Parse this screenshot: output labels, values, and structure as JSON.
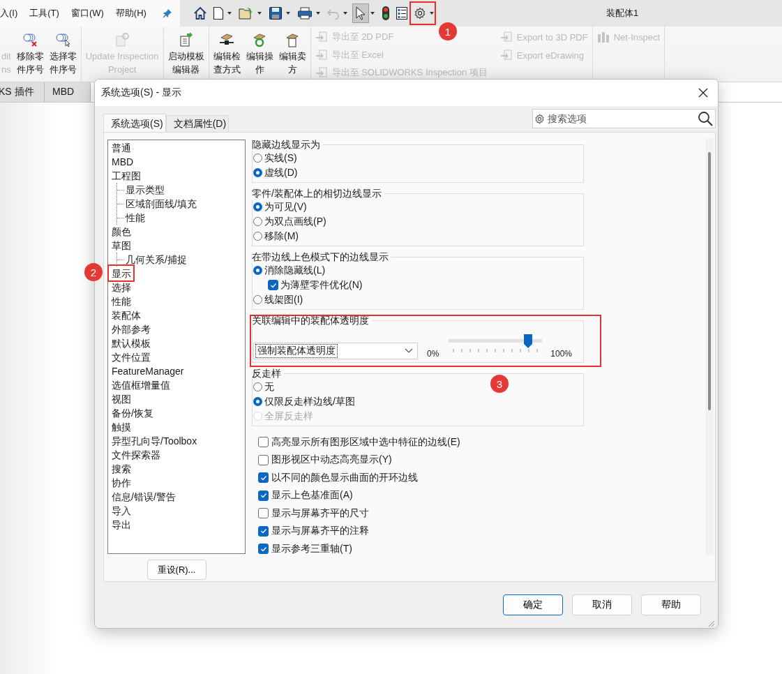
{
  "menu": [
    {
      "label": "入(I)"
    },
    {
      "label": "工具(T)"
    },
    {
      "label": "窗口(W)"
    },
    {
      "label": "帮助(H)"
    }
  ],
  "toolbar": [
    {
      "kind": "home",
      "dropdown": false,
      "pressed": false,
      "disabled": false
    },
    {
      "kind": "new",
      "dropdown": true,
      "pressed": false,
      "disabled": false
    },
    {
      "kind": "open",
      "dropdown": true,
      "pressed": false,
      "disabled": false
    },
    {
      "kind": "save",
      "dropdown": true,
      "pressed": false,
      "disabled": false
    },
    {
      "kind": "print",
      "dropdown": true,
      "pressed": false,
      "disabled": false
    },
    {
      "kind": "undo",
      "dropdown": true,
      "pressed": false,
      "disabled": true
    },
    {
      "kind": "select",
      "dropdown": true,
      "pressed": true,
      "disabled": false
    },
    {
      "kind": "light",
      "dropdown": false,
      "pressed": false,
      "disabled": false
    },
    {
      "kind": "list",
      "dropdown": false,
      "pressed": false,
      "disabled": false
    },
    {
      "kind": "gear",
      "dropdown": true,
      "pressed": false,
      "disabled": false
    }
  ],
  "title": "装配体1",
  "ribbon": [
    {
      "kind": "large",
      "commands": [
        {
          "lines": [
            "dit",
            "ns"
          ],
          "disabled": true
        },
        {
          "lines": [
            "移除零",
            "件序号"
          ],
          "disabled": false
        },
        {
          "lines": [
            "选择零",
            "件序号"
          ],
          "disabled": false
        }
      ]
    },
    {
      "kind": "large",
      "commands": [
        {
          "lines": [
            "Update Inspection",
            "Project"
          ],
          "disabled": true
        }
      ]
    },
    {
      "kind": "large",
      "commands": [
        {
          "lines": [
            "启动模板",
            "编辑器"
          ],
          "disabled": false
        }
      ]
    },
    {
      "kind": "large",
      "commands": [
        {
          "lines": [
            "编辑检",
            "查方式"
          ],
          "disabled": false
        },
        {
          "lines": [
            "编辑操",
            "作"
          ],
          "disabled": false
        },
        {
          "lines": [
            "编辑卖",
            "方"
          ],
          "disabled": false
        }
      ]
    },
    {
      "kind": "small",
      "columns": [
        [
          {
            "label": "导出至 2D PDF",
            "disabled": true
          },
          {
            "label": "导出至 Excel",
            "disabled": true
          },
          {
            "label": "导出至 SOLIDWORKS Inspection 项目",
            "disabled": true
          }
        ],
        [
          {
            "label": "Export to 3D PDF",
            "disabled": true
          },
          {
            "label": "Export eDrawing",
            "disabled": true
          }
        ]
      ]
    },
    {
      "kind": "small",
      "columns": [
        [
          {
            "label": "Net-Inspect",
            "disabled": true
          }
        ]
      ]
    }
  ],
  "tabs": [
    {
      "label": "KS 插件"
    },
    {
      "label": "MBD"
    }
  ],
  "dialog": {
    "title": "系统选项(S) - 显示",
    "tabs": [
      {
        "label": "系统选项(S)",
        "selected": true
      },
      {
        "label": "文档属性(D)",
        "selected": false
      }
    ],
    "search": {
      "placeholder": "搜索选项"
    },
    "tree": [
      {
        "label": "普通"
      },
      {
        "label": "MBD"
      },
      {
        "label": "工程图",
        "children": [
          {
            "label": "显示类型"
          },
          {
            "label": "区域剖面线/填充"
          },
          {
            "label": "性能"
          }
        ]
      },
      {
        "label": "颜色"
      },
      {
        "label": "草图",
        "children": [
          {
            "label": "几何关系/捕捉"
          }
        ]
      },
      {
        "label": "显示"
      },
      {
        "label": "选择"
      },
      {
        "label": "性能"
      },
      {
        "label": "装配体"
      },
      {
        "label": "外部参考"
      },
      {
        "label": "默认模板"
      },
      {
        "label": "文件位置"
      },
      {
        "label": "FeatureManager"
      },
      {
        "label": "选值框增量值"
      },
      {
        "label": "视图"
      },
      {
        "label": "备份/恢复"
      },
      {
        "label": "触摸"
      },
      {
        "label": "异型孔向导/Toolbox"
      },
      {
        "label": "文件探索器"
      },
      {
        "label": "搜索"
      },
      {
        "label": "协作"
      },
      {
        "label": "信息/错误/警告"
      },
      {
        "label": "导入"
      },
      {
        "label": "导出"
      }
    ],
    "reset_button": "重设(R)...",
    "groups": [
      {
        "kind": "options",
        "title": "隐藏边线显示为",
        "options": [
          {
            "kind": "radio",
            "label": "实线(S)",
            "selected": false,
            "disabled": false
          },
          {
            "kind": "radio",
            "label": "虚线(D)",
            "selected": true,
            "disabled": false
          }
        ]
      },
      {
        "kind": "options",
        "title": "零件/装配体上的相切边线显示",
        "options": [
          {
            "kind": "radio",
            "label": "为可见(V)",
            "selected": true,
            "disabled": false
          },
          {
            "kind": "radio",
            "label": "为双点画线(P)",
            "selected": false,
            "disabled": false
          },
          {
            "kind": "radio",
            "label": "移除(M)",
            "selected": false,
            "disabled": false
          }
        ]
      },
      {
        "kind": "options",
        "title": "在带边线上色模式下的边线显示",
        "options": [
          {
            "kind": "radio",
            "label": "消除隐藏线(L)",
            "selected": true,
            "disabled": false
          },
          {
            "kind": "checkbox",
            "label": "为薄壁零件优化(N)",
            "checked": true,
            "disabled": false
          },
          {
            "kind": "radio",
            "label": "线架图(I)",
            "selected": false,
            "disabled": false
          }
        ]
      },
      {
        "kind": "transparency",
        "title": "关联编辑中的装配体透明度",
        "dropdown": "强制装配体透明度",
        "level": 0.85,
        "min_label": "0%",
        "max_label": "100%"
      },
      {
        "kind": "options",
        "title": "反走样",
        "options": [
          {
            "kind": "radio",
            "label": "无",
            "selected": false,
            "disabled": false
          },
          {
            "kind": "radio",
            "label": "仅限反走样边线/草图",
            "selected": true,
            "disabled": false
          },
          {
            "kind": "radio",
            "label": "全屏反走样",
            "selected": false,
            "disabled": true
          }
        ]
      }
    ],
    "checkboxes": [
      {
        "label": "高亮显示所有图形区域中选中特征的边线(E)",
        "checked": false
      },
      {
        "label": "图形视区中动态高亮显示(Y)",
        "checked": false
      },
      {
        "label": "以不同的颜色显示曲面的开环边线",
        "checked": true
      },
      {
        "label": "显示上色基准面(A)",
        "checked": true
      },
      {
        "label": "显示与屏幕齐平的尺寸",
        "checked": false
      },
      {
        "label": "显示与屏幕齐平的注释",
        "checked": true
      },
      {
        "label": "显示参考三重轴(T)",
        "checked": true
      }
    ],
    "buttons": [
      {
        "label": "确定",
        "default": true
      },
      {
        "label": "取消",
        "default": false
      },
      {
        "label": "帮助",
        "default": false
      }
    ]
  },
  "annotations": [
    {
      "label": "1"
    },
    {
      "label": "2"
    },
    {
      "label": "3"
    }
  ]
}
